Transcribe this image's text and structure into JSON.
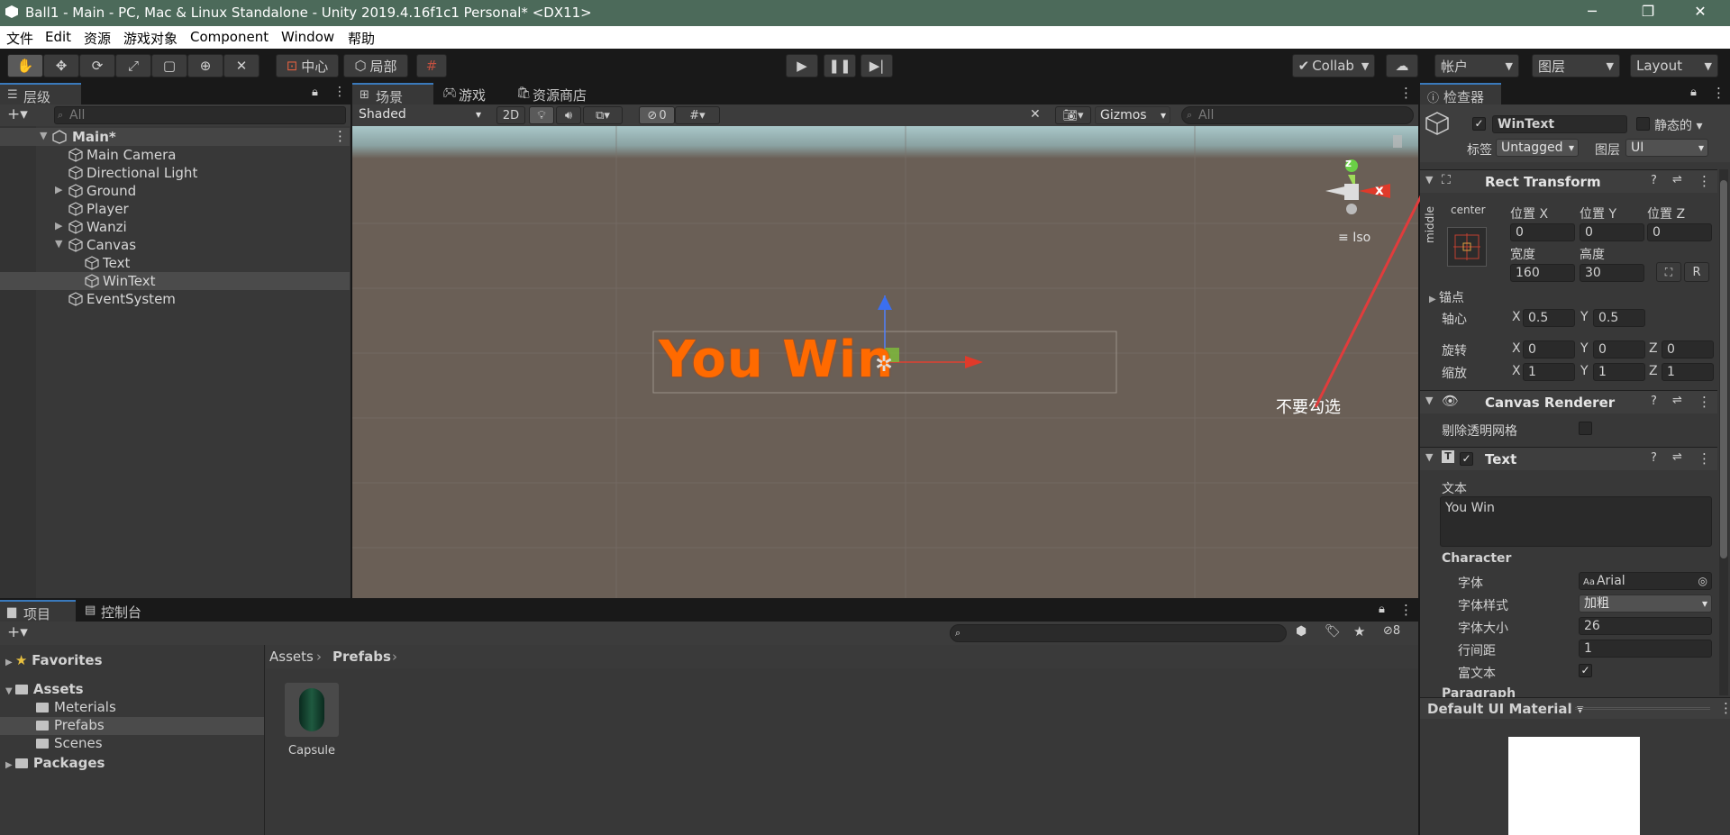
{
  "window": {
    "title": "Ball1 - Main - PC, Mac & Linux Standalone - Unity 2019.4.16f1c1 Personal* <DX11>",
    "minimize": "─",
    "restore": "❐",
    "close": "✕"
  },
  "menu": [
    "文件",
    "Edit",
    "资源",
    "游戏对象",
    "Component",
    "Window",
    "帮助"
  ],
  "toolbar": {
    "pivot_label": "中心",
    "local_label": "局部",
    "collab_label": "Collab",
    "account_label": "帐户",
    "layers_label": "图层",
    "layout_label": "Layout"
  },
  "hierarchy": {
    "tab_label": "层级",
    "search_placeholder": "All",
    "scene_name": "Main*",
    "items": [
      "Main Camera",
      "Directional Light",
      "Ground",
      "Player",
      "Wanzi",
      "Canvas",
      "Text",
      "WinText",
      "EventSystem"
    ]
  },
  "scene": {
    "tabs": [
      "场景",
      "游戏",
      "资源商店"
    ],
    "draw_mode": "Shaded",
    "mode_2d": "2D",
    "hidden_count": "0",
    "gizmos_label": "Gizmos",
    "search_placeholder": "All",
    "iso_label": "Iso",
    "axis_x": "x",
    "axis_z": "z",
    "canvas_text": "You Win",
    "annotation": "不要勾选"
  },
  "project": {
    "tabs": [
      "项目",
      "控制台"
    ],
    "tree": [
      "Favorites",
      "Assets",
      "Meterials",
      "Prefabs",
      "Scenes",
      "Packages"
    ],
    "breadcrumb": [
      "Assets",
      "Prefabs"
    ],
    "hidden_count": "8",
    "assets": [
      "Capsule"
    ]
  },
  "inspector": {
    "tab_label": "检查器",
    "object_name": "WinText",
    "static_label": "静态的",
    "tag_label": "标签",
    "tag_value": "Untagged",
    "layer_label": "图层",
    "layer_value": "UI",
    "rect": {
      "title": "Rect Transform",
      "anchor_h": "center",
      "anchor_v": "middle",
      "pos_x_label": "位置 X",
      "pos_y_label": "位置 Y",
      "pos_z_label": "位置 Z",
      "pos_x": "0",
      "pos_y": "0",
      "pos_z": "0",
      "width_label": "宽度",
      "height_label": "高度",
      "width": "160",
      "height": "30",
      "r_button": "R",
      "anchors_label": "锚点",
      "pivot_label": "轴心",
      "pivot_x": "0.5",
      "pivot_y": "0.5",
      "rotation_label": "旋转",
      "rot_x": "0",
      "rot_y": "0",
      "rot_z": "0",
      "scale_label": "缩放",
      "scale_x": "1",
      "scale_y": "1",
      "scale_z": "1",
      "axis_x": "X",
      "axis_y": "Y",
      "axis_z": "Z"
    },
    "canvas_renderer": {
      "title": "Canvas Renderer",
      "cull_label": "剔除透明网格"
    },
    "text": {
      "title": "Text",
      "text_label": "文本",
      "text_value": "You Win",
      "character_label": "Character",
      "font_label": "字体",
      "font_value": "Arial",
      "font_prefix": "Aa",
      "style_label": "字体样式",
      "style_value": "加粗",
      "size_label": "字体大小",
      "size_value": "26",
      "spacing_label": "行间距",
      "spacing_value": "1",
      "rich_label": "富文本",
      "paragraph_label": "Paragraph"
    },
    "material_label": "Default UI Material"
  },
  "colors": {
    "accent": "#3a79bb",
    "annotation_red": "#e03c3c",
    "win_text": "#ff6a00"
  }
}
